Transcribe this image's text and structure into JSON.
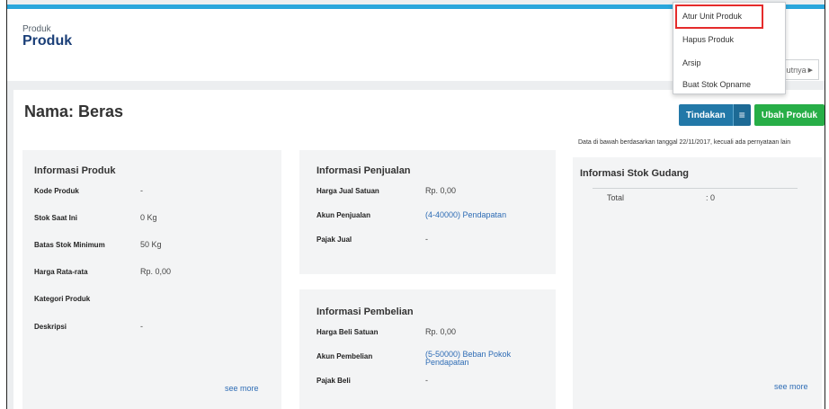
{
  "header": {
    "breadcrumb": "Produk",
    "title": "Produk",
    "next_label": "jutnya"
  },
  "product": {
    "name_title": "Nama: Beras"
  },
  "actions": {
    "tindakan_label": "Tindakan",
    "menu_icon": "≡",
    "ubah_label": "Ubah Produk"
  },
  "date_note": "Data di bawah berdasarkan tanggal 22/11/2017, kecuali ada pernyataan lain",
  "info_produk": {
    "title": "Informasi Produk",
    "rows": [
      {
        "label": "Kode Produk",
        "value": "-"
      },
      {
        "label": "Stok Saat Ini",
        "value": "0 Kg"
      },
      {
        "label": "Batas Stok Minimum",
        "value": "50 Kg"
      },
      {
        "label": "Harga Rata-rata",
        "value": "Rp. 0,00"
      },
      {
        "label": "Kategori Produk",
        "value": ""
      },
      {
        "label": "Deskripsi",
        "value": "-"
      }
    ],
    "see_more": "see more"
  },
  "info_penjualan": {
    "title": "Informasi Penjualan",
    "rows": [
      {
        "label": "Harga Jual Satuan",
        "value": "Rp. 0,00"
      },
      {
        "label": "Akun Penjualan",
        "value": "(4-40000) Pendapatan"
      },
      {
        "label": "Pajak Jual",
        "value": "-"
      }
    ]
  },
  "info_pembelian": {
    "title": "Informasi Pembelian",
    "rows": [
      {
        "label": "Harga Beli Satuan",
        "value": "Rp. 0,00"
      },
      {
        "label": "Akun Pembelian",
        "value": "(5-50000) Beban Pokok Pendapatan"
      },
      {
        "label": "Pajak Beli",
        "value": "-"
      }
    ]
  },
  "info_stok": {
    "title": "Informasi Stok Gudang",
    "total_label": "Total",
    "total_value": ": 0",
    "see_more": "see more"
  },
  "dropdown": {
    "items": [
      "Atur Unit Produk",
      "Hapus Produk",
      "Arsip",
      "Buat Stok Opname"
    ]
  },
  "colors": {
    "topbar": "#2aa6dc",
    "title_blue": "#1b3f78",
    "tindakan": "#2278a8",
    "ubah": "#27ae47",
    "link": "#2e6cb5",
    "highlight": "#e52b2b"
  }
}
